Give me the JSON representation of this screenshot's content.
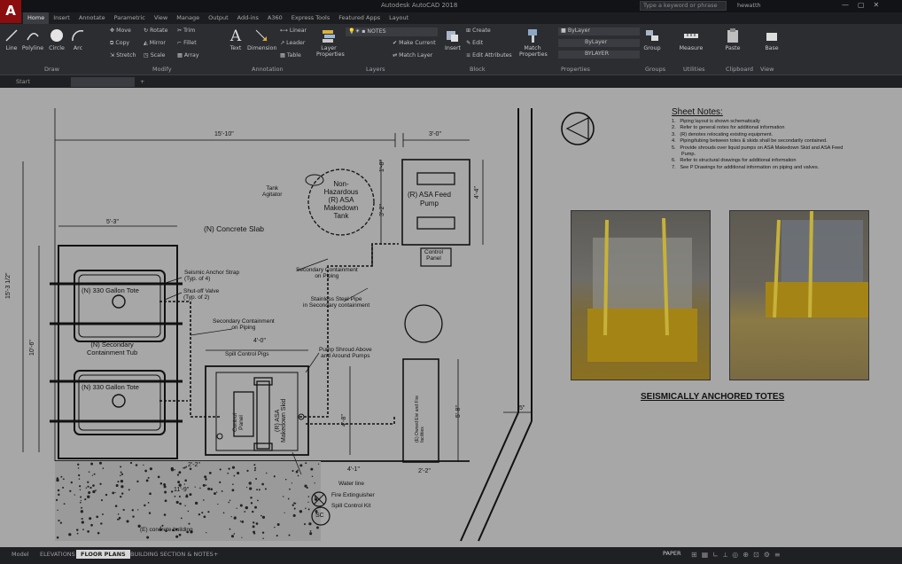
{
  "app": {
    "title": "Autodesk AutoCAD 2018",
    "logo": "A",
    "search_placeholder": "Type a keyword or phrase",
    "user": "hewatth"
  },
  "ribbon_tabs": [
    "Home",
    "Insert",
    "Annotate",
    "Parametric",
    "View",
    "Manage",
    "Output",
    "Add-ins",
    "A360",
    "Express Tools",
    "Featured Apps",
    "Layout"
  ],
  "ribbon": {
    "draw": {
      "label": "Draw",
      "line": "Line",
      "polyline": "Polyline",
      "circle": "Circle",
      "arc": "Arc"
    },
    "modify": {
      "label": "Modify",
      "move": "Move",
      "rotate": "Rotate",
      "trim": "Trim",
      "copy": "Copy",
      "mirror": "Mirror",
      "fillet": "Fillet",
      "stretch": "Stretch",
      "scale": "Scale",
      "array": "Array"
    },
    "annotation": {
      "label": "Annotation",
      "text": "Text",
      "dimension": "Dimension",
      "linear": "Linear",
      "leader": "Leader",
      "table": "Table"
    },
    "layers": {
      "label": "Layers",
      "layer_properties": "Layer Properties",
      "current_layer": "NOTES",
      "make_current": "Make Current",
      "match_layer": "Match Layer"
    },
    "block": {
      "label": "Block",
      "insert": "Insert",
      "create": "Create",
      "edit": "Edit",
      "edit_attributes": "Edit Attributes"
    },
    "properties": {
      "label": "Properties",
      "match": "Match Properties",
      "color": "ByLayer",
      "linetype": "ByLayer",
      "lineweight": "BYLAYER"
    },
    "groups": {
      "label": "Groups",
      "group": "Group"
    },
    "utilities": {
      "label": "Utilities",
      "measure": "Measure"
    },
    "clipboard": {
      "label": "Clipboard",
      "paste": "Paste"
    },
    "view": {
      "label": "View",
      "base": "Base"
    }
  },
  "doc_tabs": [
    "Start",
    ""
  ],
  "drawing": {
    "sheet_notes_title": "Sheet Notes:",
    "sheet_notes": [
      "1.   Piping layout is shown schematically",
      "2.   Refer to general notes for additional information",
      "3.   (R) denotes relocating existing equipment.",
      "4.   Piping/tubing between totes & skids shall be secondarily contained.",
      "5.   Provide shrouds over liquid pumps on ASA Makedown Skid and ASA Feed",
      "       Pump.",
      "6.   Refer to structural drawings for additional information",
      "7.   See P Drawings for additional information on piping and valves."
    ],
    "photos_caption": "SEISMICALLY ANCHORED TOTES",
    "labels": {
      "dim_15_10": "15'-10\"",
      "dim_3_0": "3'-0\"",
      "dim_5_3": "5'-3\"",
      "dim_15_3": "15'-3 1/2\"",
      "dim_10_6": "10'-6\"",
      "dim_4_0": "4'-0\"",
      "dim_4_1": "4'-1\"",
      "dim_2_2": "2'-2\"",
      "dim_11_9": "11'-9\"",
      "dim_2_2b": "2'-2\"",
      "dim_5_8": "5'-8\"",
      "dim_1_8": "1'-8\"",
      "dim_3_2": "3'-2\"",
      "dim_4_4": "4'-4\"",
      "dim_4_8": "4'-8\"",
      "dim_5": "5\"",
      "concrete_slab": "(N) Concrete Slab",
      "tank": "Non-\nHazardous\n(R) ASA\nMakedown\nTank",
      "tank_agitator": "Tank\nAgitator",
      "feed_pump": "(R) ASA Feed\nPump",
      "control_panel": "Control\nPanel",
      "tote1": "(N) 330 Gallon Tote",
      "tote2": "(N) 330 Gallon Tote",
      "tub": "(N) Secondary\nContainment Tub",
      "strap": "Seismic Anchor Strap\n(Typ. of 4)",
      "shutoff": "Shut-off Valve\n(Typ. of 2)",
      "sec_cont": "Secondary Containment\non Piping",
      "sec_cont2": "Secondary Containment\non Piping",
      "ss_pipe": "Stainless Steel Pipe\nin Secondary containment",
      "spill_pigs": "Spill Control Pigs",
      "pump_shroud": "Pump Shroud Above\nand Around Pumps",
      "skid_panel": "Control\nPanel",
      "skid": "(R) ASA\nMakedown Skid",
      "owner": "(E) Owned Eivi and Fire\nfacilities",
      "water_line": "Water line",
      "extinguisher": "Fire Extinguisher",
      "spill_kit": "Spill Control Kit",
      "sc": "SC",
      "existing_bldg": "(E) concrete building"
    }
  },
  "layout_tabs": [
    "Model",
    "ELEVATIONS",
    "FLOOR PLANS",
    "BUILDING SECTION & NOTES"
  ],
  "status": {
    "paper": "PAPER"
  }
}
